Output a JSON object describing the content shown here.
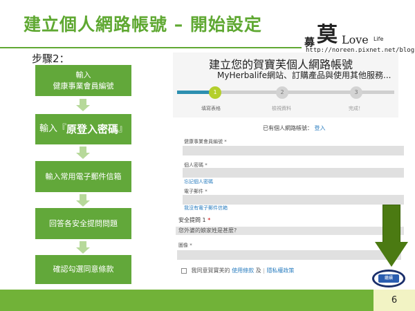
{
  "slide": {
    "title": "建立個人網路帳號 – 開始設定",
    "step_label": "步驟2：",
    "page_number": "6",
    "accent_color": "#5fa832"
  },
  "logo": {
    "prefix": "募",
    "big": "莫",
    "love": "Love",
    "life": "Life",
    "url": "http://noreen.pixnet.net/blog"
  },
  "flow": {
    "steps": [
      {
        "line1": "輸入",
        "line2": "健康事業會員編號"
      },
      {
        "pre": "輸入『",
        "bold": "原登入密碼",
        "post": "』"
      },
      {
        "line1": "輸入常用電子郵件信箱"
      },
      {
        "line1": "回答各安全提問問題"
      },
      {
        "line1": "確認勾選同意條款"
      }
    ]
  },
  "form": {
    "header_title": "建立您的賀寶芙個人網路帳號",
    "header_subtitle": "MyHerbalife網站、訂購產品與使用其他服務...",
    "progress": {
      "steps": [
        {
          "num": "1",
          "label": "填寫表格",
          "state": "active"
        },
        {
          "num": "2",
          "label": "檢視資料",
          "state": "inactive"
        },
        {
          "num": "3",
          "label": "完成！",
          "state": "inactive"
        }
      ],
      "fraction": 0.18
    },
    "have_account_text": "已有個人網路帳號：",
    "have_account_link": "登入",
    "member_id_label": "健康事業會員編號 *",
    "password_label": "個人密碼 *",
    "forgot_password_link": "忘記個人密碼",
    "email_label": "電子郵件 *",
    "no_email_link": "我沒有電子郵件信箱",
    "security_label": "安全提問 1",
    "security_required": "*",
    "security_question": "您外婆的娘家姓是甚麼?",
    "captcha_label": "圖像 *",
    "agree_text": "我同意賀寶芙的",
    "terms_link": "使用條款",
    "and_text": "及",
    "privacy_link": "隱私權政策",
    "continue_label": "繼續"
  }
}
